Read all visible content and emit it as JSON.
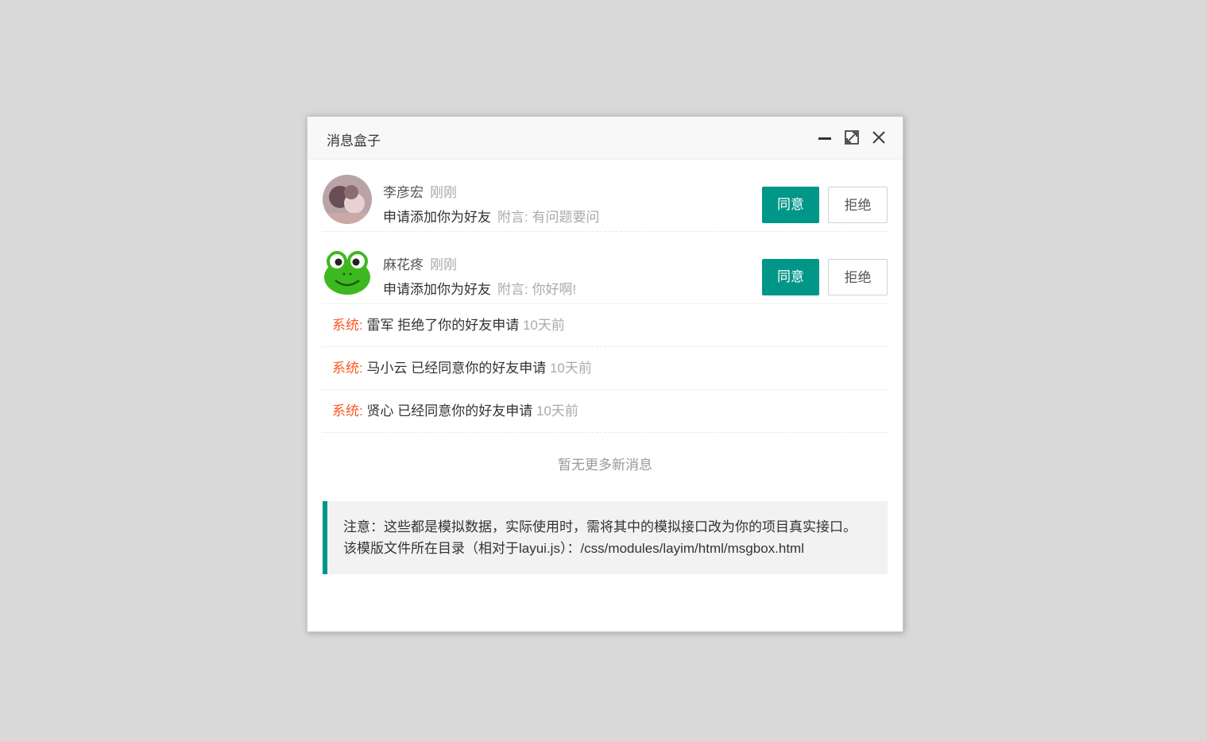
{
  "window": {
    "title": "消息盒子"
  },
  "requests": [
    {
      "name": "李彦宏",
      "time": "刚刚",
      "message": "申请添加你为好友",
      "note": "附言: 有问题要问",
      "agree": "同意",
      "refuse": "拒绝"
    },
    {
      "name": "麻花疼",
      "time": "刚刚",
      "message": "申请添加你为好友",
      "note": "附言: 你好啊!",
      "agree": "同意",
      "refuse": "拒绝"
    }
  ],
  "system_messages": [
    {
      "label": "系统:",
      "text": "雷军 拒绝了你的好友申请",
      "time": "10天前"
    },
    {
      "label": "系统:",
      "text": "马小云 已经同意你的好友申请",
      "time": "10天前"
    },
    {
      "label": "系统:",
      "text": "贤心 已经同意你的好友申请",
      "time": "10天前"
    }
  ],
  "no_more": "暂无更多新消息",
  "notice": {
    "line1": "注意：这些都是模拟数据，实际使用时，需将其中的模拟接口改为你的项目真实接口。",
    "line2": "该模版文件所在目录（相对于layui.js）：/css/modules/layim/html/msgbox.html"
  },
  "colors": {
    "accent": "#009688",
    "system": "#ff5722"
  }
}
